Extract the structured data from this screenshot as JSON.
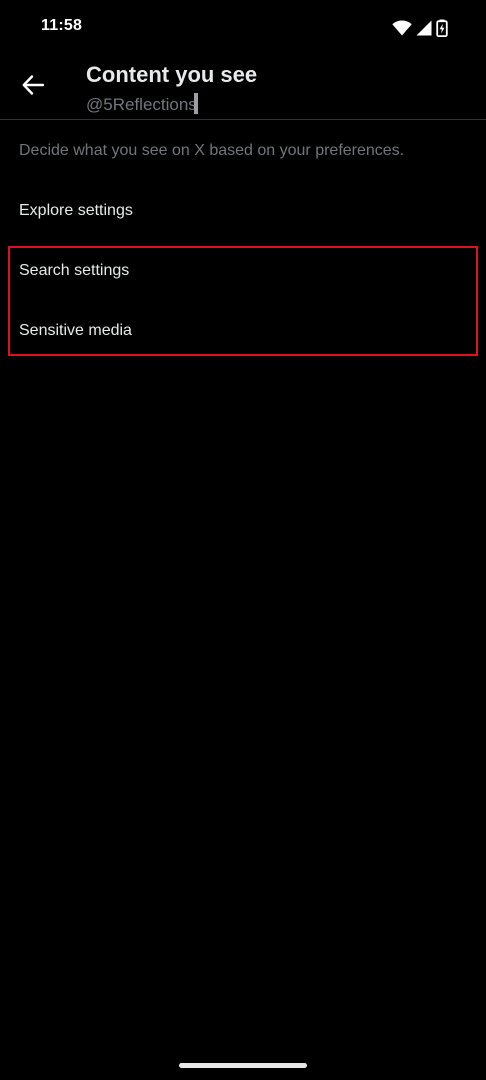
{
  "status_bar": {
    "time": "11:58",
    "icons": [
      "wifi-icon",
      "cell-signal-icon",
      "battery-charging-icon"
    ]
  },
  "header": {
    "title": "Content you see",
    "subtitle": "@5Reflections",
    "back_icon": "back-arrow-icon"
  },
  "description": "Decide what you see on X based on your preferences.",
  "menu": {
    "items": [
      {
        "label": "Explore settings"
      },
      {
        "label": "Search settings"
      },
      {
        "label": "Sensitive media"
      }
    ]
  },
  "colors": {
    "background": "#000000",
    "primary_text": "#e7e9ea",
    "secondary_text": "#71767b",
    "divider": "#2f3336",
    "highlight": "#e0101c"
  }
}
